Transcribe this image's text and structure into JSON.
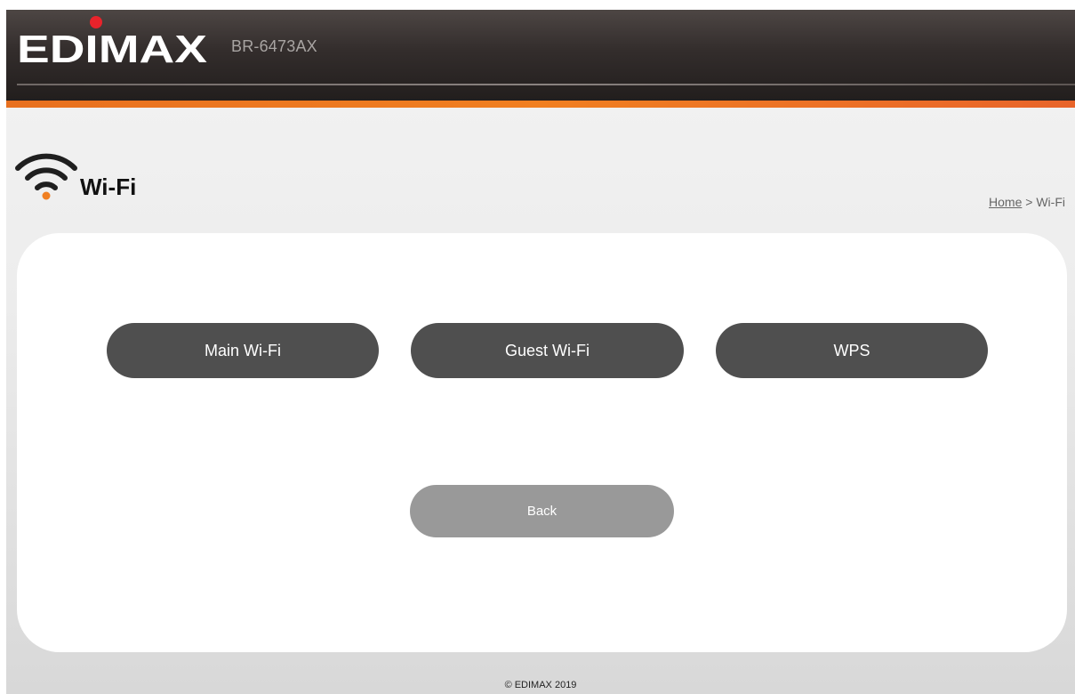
{
  "brand": {
    "logo_text": "EDIMAX",
    "model": "BR-6473AX"
  },
  "page": {
    "title": "Wi-Fi",
    "icon": "wifi-icon"
  },
  "breadcrumb": {
    "home": "Home",
    "separator": ">",
    "current": "Wi-Fi"
  },
  "menu": {
    "main_wifi": "Main Wi-Fi",
    "guest_wifi": "Guest Wi-Fi",
    "wps": "WPS",
    "back": "Back"
  },
  "footer": {
    "copyright": "© EDIMAX 2019"
  },
  "colors": {
    "accent_orange": "#f07f21",
    "logo_dot": "#e8232b",
    "button_dark": "#4f4f4f",
    "button_back": "#999999"
  }
}
